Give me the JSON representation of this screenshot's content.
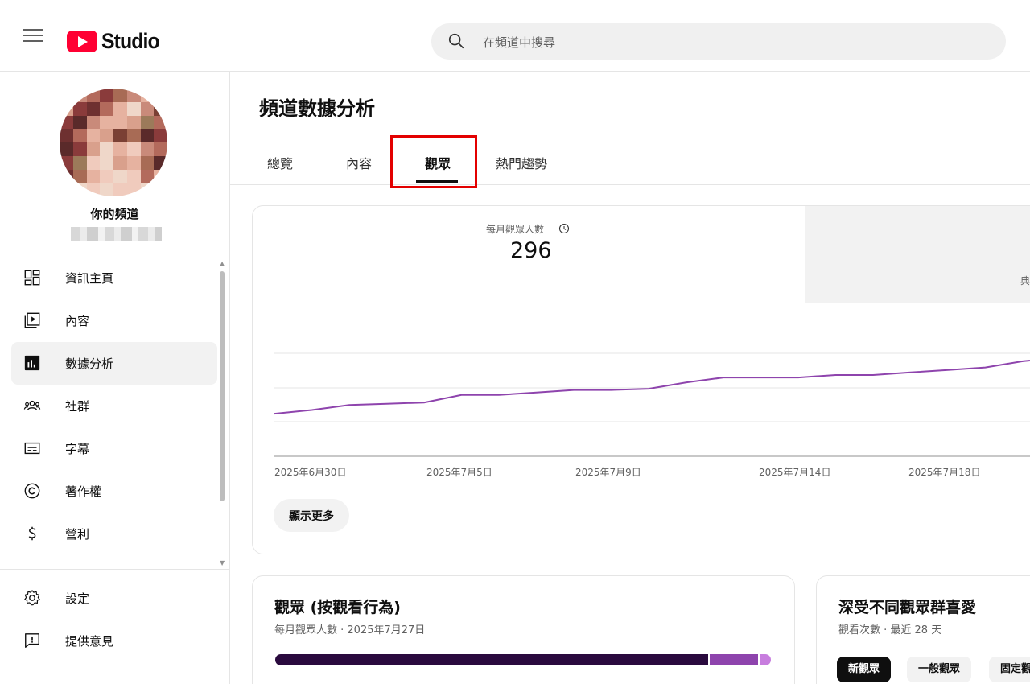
{
  "header": {
    "logo_text": "Studio",
    "search_placeholder": "在頻道中搜尋",
    "brand_color": "#ff0033"
  },
  "sidebar": {
    "channel_title": "你的頻道",
    "items": [
      {
        "label": "資訊主頁",
        "icon": "dashboard-icon"
      },
      {
        "label": "內容",
        "icon": "content-icon"
      },
      {
        "label": "數據分析",
        "icon": "analytics-icon",
        "active": true
      },
      {
        "label": "社群",
        "icon": "community-icon"
      },
      {
        "label": "字幕",
        "icon": "subtitles-icon"
      },
      {
        "label": "著作權",
        "icon": "copyright-icon"
      },
      {
        "label": "營利",
        "icon": "monetization-icon"
      }
    ],
    "bottom_items": [
      {
        "label": "設定",
        "icon": "settings-icon"
      },
      {
        "label": "提供意見",
        "icon": "feedback-icon"
      }
    ]
  },
  "main": {
    "title": "頻道數據分析",
    "tabs": [
      {
        "label": "總覽"
      },
      {
        "label": "內容"
      },
      {
        "label": "觀眾",
        "active": true
      },
      {
        "label": "熱門趨勢"
      }
    ],
    "metric": {
      "label": "每月觀眾人數",
      "value": "296",
      "partial_label": "典"
    },
    "show_more_label": "顯示更多",
    "audience_card": {
      "title": "觀眾 (按觀看行為)",
      "subtitle": "每月觀眾人數 · 2025年7月27日"
    },
    "fans_card": {
      "title": "深受不同觀眾群喜愛",
      "subtitle": "觀看次數 · 最近 28 天",
      "chips": [
        "新觀眾",
        "一般觀眾",
        "固定觀眾"
      ]
    }
  },
  "chart_data": {
    "type": "line",
    "x": [
      "2025年6月30日",
      "2025年7月5日",
      "2025年7月9日",
      "2025年7月14日",
      "2025年7月18日"
    ],
    "series": [
      {
        "values": [
          244,
          247,
          251,
          252,
          253,
          259,
          259,
          261,
          263,
          263,
          264,
          269,
          273,
          273,
          273,
          275,
          275,
          277,
          279,
          281,
          286,
          289
        ]
      }
    ],
    "ylim": [
      210,
      320
    ],
    "line_color": "#8e44ad",
    "grid": true
  }
}
